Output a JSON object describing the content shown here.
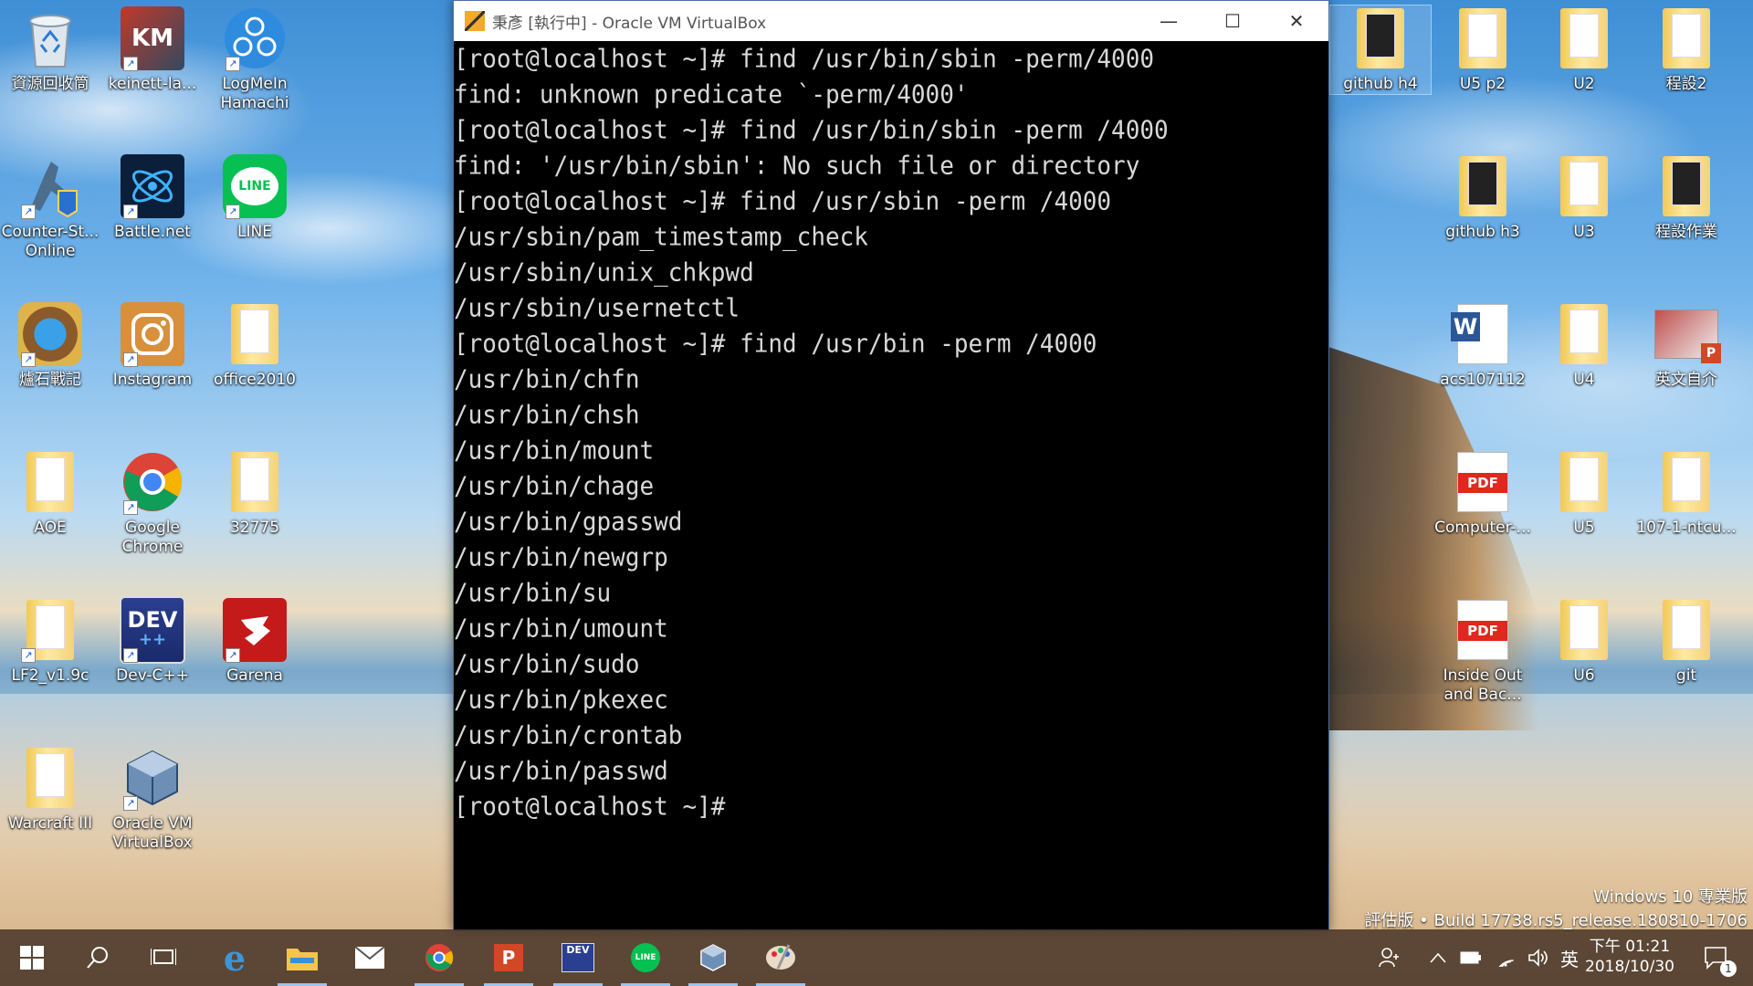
{
  "desktop": {
    "icons_left": [
      {
        "label": "資源回收筒",
        "icon": "recycle-bin-icon"
      },
      {
        "label": "keinett-la...",
        "icon": "app-icon"
      },
      {
        "label": "LogMeIn Hamachi",
        "icon": "hamachi-icon"
      },
      {
        "label": "Counter-St... Online",
        "icon": "counter-strike-icon"
      },
      {
        "label": "Battle.net",
        "icon": "battlenet-icon"
      },
      {
        "label": "LINE",
        "icon": "line-icon"
      },
      {
        "label": "爐石戰記",
        "icon": "hearthstone-icon"
      },
      {
        "label": "Instagram",
        "icon": "instagram-icon"
      },
      {
        "label": "office2010",
        "icon": "folder-icon"
      },
      {
        "label": "AOE",
        "icon": "folder-icon"
      },
      {
        "label": "Google Chrome",
        "icon": "chrome-icon"
      },
      {
        "label": "32775",
        "icon": "folder-icon"
      },
      {
        "label": "LF2_v1.9c",
        "icon": "folder-icon"
      },
      {
        "label": "Dev-C++",
        "icon": "devcpp-icon"
      },
      {
        "label": "Garena",
        "icon": "garena-icon"
      },
      {
        "label": "Warcraft III",
        "icon": "folder-icon"
      },
      {
        "label": "Oracle VM VirtualBox",
        "icon": "virtualbox-icon"
      }
    ],
    "icons_right": [
      {
        "label": "github h4",
        "icon": "folder-icon"
      },
      {
        "label": "U5 p2",
        "icon": "folder-icon"
      },
      {
        "label": "U2",
        "icon": "folder-icon"
      },
      {
        "label": "程設2",
        "icon": "folder-icon"
      },
      {
        "label": "github h3",
        "icon": "folder-icon"
      },
      {
        "label": "U3",
        "icon": "folder-icon"
      },
      {
        "label": "程設作業",
        "icon": "folder-icon"
      },
      {
        "label": "acs107112",
        "icon": "word-icon"
      },
      {
        "label": "U4",
        "icon": "folder-icon"
      },
      {
        "label": "英文自介",
        "icon": "powerpoint-icon"
      },
      {
        "label": "Computer-...",
        "icon": "pdf-icon"
      },
      {
        "label": "U5",
        "icon": "folder-icon"
      },
      {
        "label": "107-1-ntcu...",
        "icon": "folder-icon"
      },
      {
        "label": "Inside Out and Bac...",
        "icon": "pdf-icon"
      },
      {
        "label": "U6",
        "icon": "folder-icon"
      },
      {
        "label": "git",
        "icon": "folder-icon"
      }
    ],
    "pdf_badge": "PDF",
    "dev_badge": "DEV",
    "line_badge": "LINE",
    "watermark": {
      "line1": "Windows 10 專業版",
      "line2": "評估版 • Build 17738.rs5_release.180810-1706"
    }
  },
  "window": {
    "title": "秉彥 [執行中] - Oracle VM VirtualBox",
    "minimize": "—",
    "maximize": "☐",
    "close": "✕"
  },
  "terminal": {
    "lines": [
      "[root@localhost ~]# find /usr/bin/sbin -perm/4000",
      "find: unknown predicate `-perm/4000'",
      "[root@localhost ~]# find /usr/bin/sbin -perm /4000",
      "find: '/usr/bin/sbin': No such file or directory",
      "[root@localhost ~]# find /usr/sbin -perm /4000",
      "/usr/sbin/pam_timestamp_check",
      "/usr/sbin/unix_chkpwd",
      "/usr/sbin/usernetctl",
      "[root@localhost ~]# find /usr/bin -perm /4000",
      "/usr/bin/chfn",
      "/usr/bin/chsh",
      "/usr/bin/mount",
      "/usr/bin/chage",
      "/usr/bin/gpasswd",
      "/usr/bin/newgrp",
      "/usr/bin/su",
      "/usr/bin/umount",
      "/usr/bin/sudo",
      "/usr/bin/pkexec",
      "/usr/bin/crontab",
      "/usr/bin/passwd",
      "[root@localhost ~]#"
    ]
  },
  "taskbar": {
    "buttons": [
      {
        "name": "start-button",
        "glyph": "⊞"
      },
      {
        "name": "search-button",
        "glyph": "⚲"
      },
      {
        "name": "task-view-button",
        "glyph": "⧉"
      },
      {
        "name": "edge-button",
        "glyph": "e"
      },
      {
        "name": "file-explorer-button",
        "glyph": "▬"
      },
      {
        "name": "mail-button",
        "glyph": "✉"
      },
      {
        "name": "chrome-button",
        "glyph": "◉"
      },
      {
        "name": "powerpoint-button",
        "glyph": "P"
      },
      {
        "name": "devcpp-button",
        "glyph": "DEV"
      },
      {
        "name": "line-button",
        "glyph": "LINE"
      },
      {
        "name": "virtualbox-button",
        "glyph": "⬡"
      },
      {
        "name": "paint-button",
        "glyph": "✎"
      }
    ],
    "tray": {
      "people": "⚇",
      "chevron": "^",
      "battery": "▭",
      "wifi": "◜",
      "volume": "🕪",
      "ime": "英",
      "time": "下午 01:21",
      "date": "2018/10/30",
      "notification_count": "1"
    }
  }
}
